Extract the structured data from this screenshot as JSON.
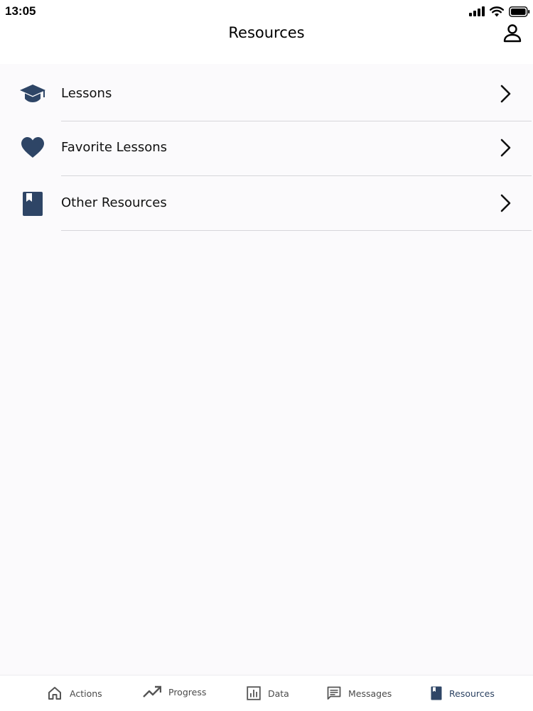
{
  "status_bar": {
    "time": "13:05"
  },
  "header": {
    "title": "Resources"
  },
  "colors": {
    "accent": "#2e4566",
    "divider": "#d6d6da",
    "background": "#fbfafc"
  },
  "list": {
    "items": [
      {
        "label": "Lessons",
        "icon": "graduation-cap-icon"
      },
      {
        "label": "Favorite Lessons",
        "icon": "heart-icon"
      },
      {
        "label": "Other Resources",
        "icon": "bookmark-book-icon"
      }
    ]
  },
  "tabbar": {
    "tabs": [
      {
        "label": "Actions",
        "icon": "home-icon",
        "active": false
      },
      {
        "label": "Progress",
        "icon": "trending-up-icon",
        "active": false
      },
      {
        "label": "Data",
        "icon": "bar-chart-icon",
        "active": false
      },
      {
        "label": "Messages",
        "icon": "message-icon",
        "active": false
      },
      {
        "label": "Resources",
        "icon": "book-icon",
        "active": true
      }
    ]
  }
}
